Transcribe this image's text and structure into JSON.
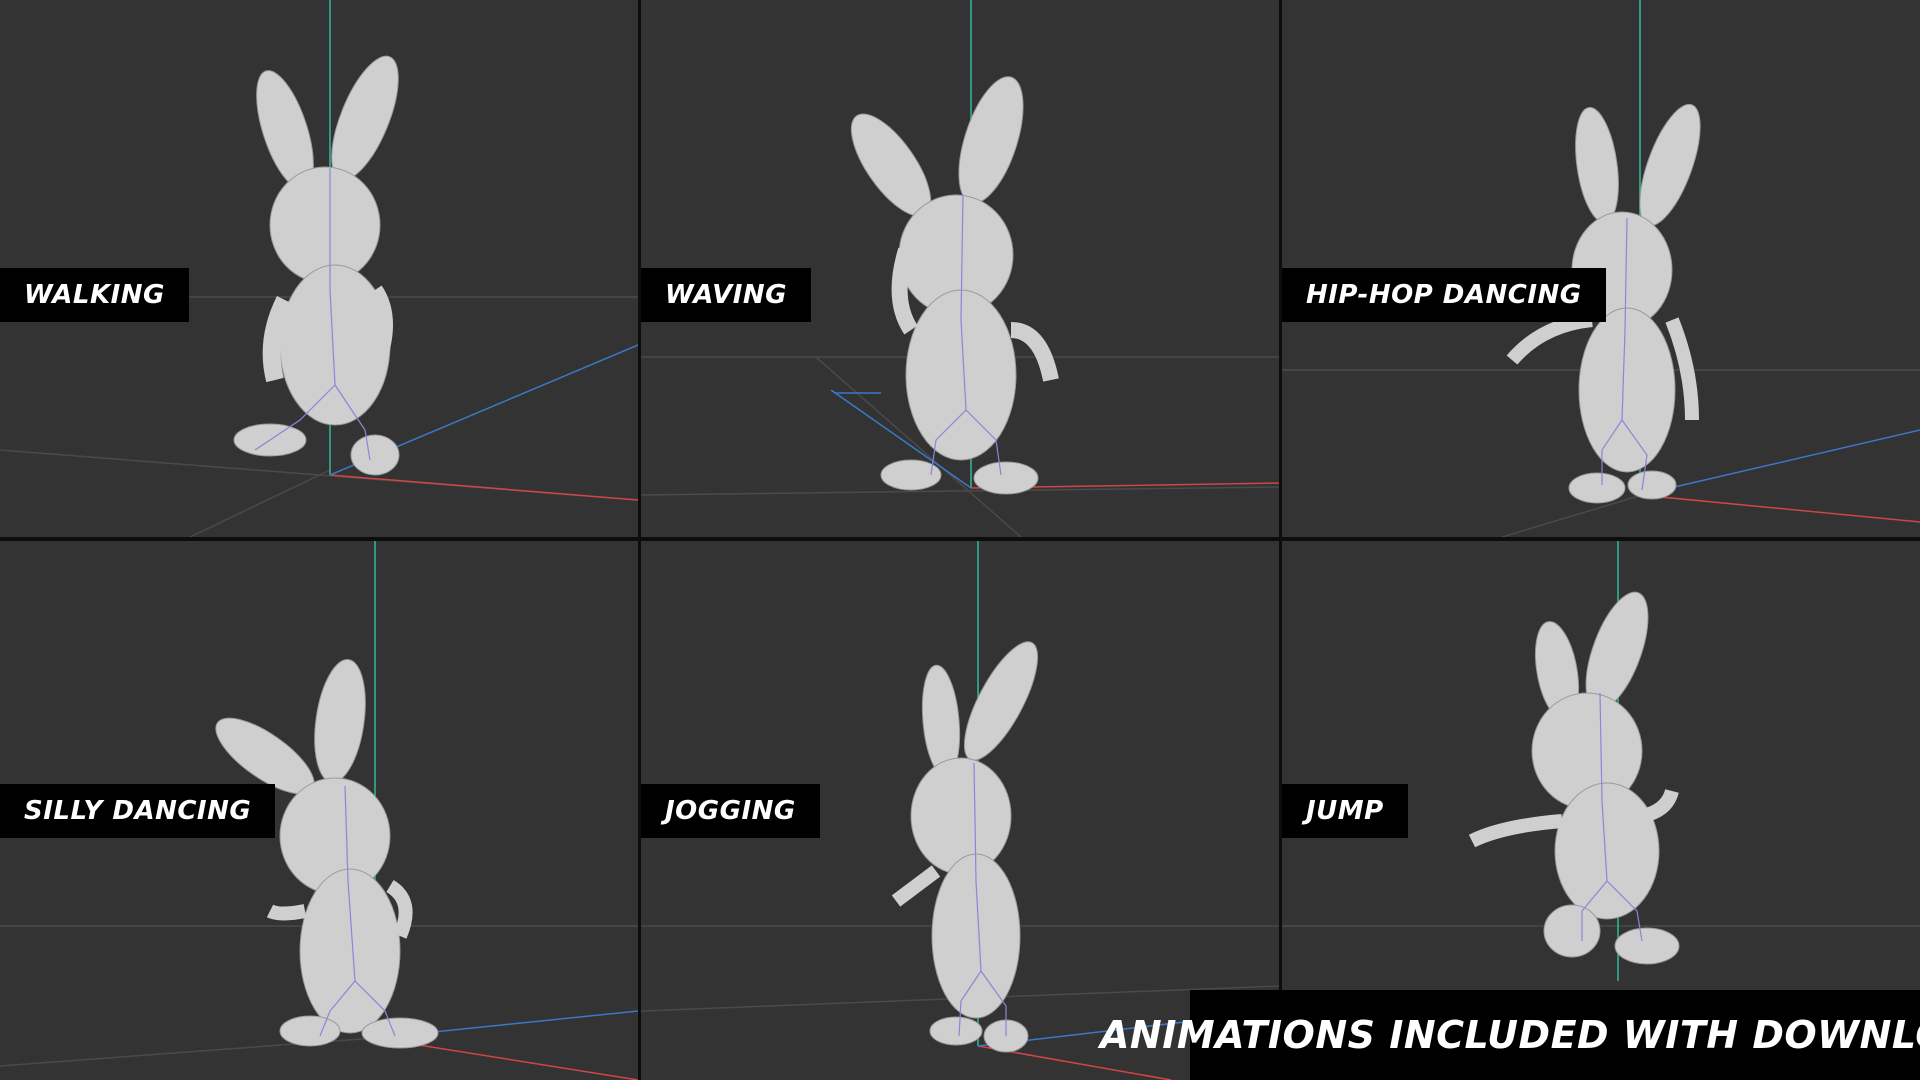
{
  "viewports": [
    {
      "label": "WALKING"
    },
    {
      "label": "WAVING"
    },
    {
      "label": "HIP-HOP DANCING"
    },
    {
      "label": "SILLY DANCING"
    },
    {
      "label": "JOGGING"
    },
    {
      "label": "JUMP"
    }
  ],
  "banner": {
    "text": "ANIMATIONS INCLUDED WITH DOWNLOAD"
  },
  "colors": {
    "viewport_bg": "#333333",
    "divider": "#0d0d0d",
    "axis_x": "#d04545",
    "axis_y": "#3a78c8",
    "axis_z": "#34b89a",
    "grid_line": "#4a4a4a",
    "model": "#cfcfcf",
    "label_bg": "#000000",
    "label_text": "#ffffff"
  },
  "icons": [
    "bunny-model",
    "armature-bones"
  ]
}
